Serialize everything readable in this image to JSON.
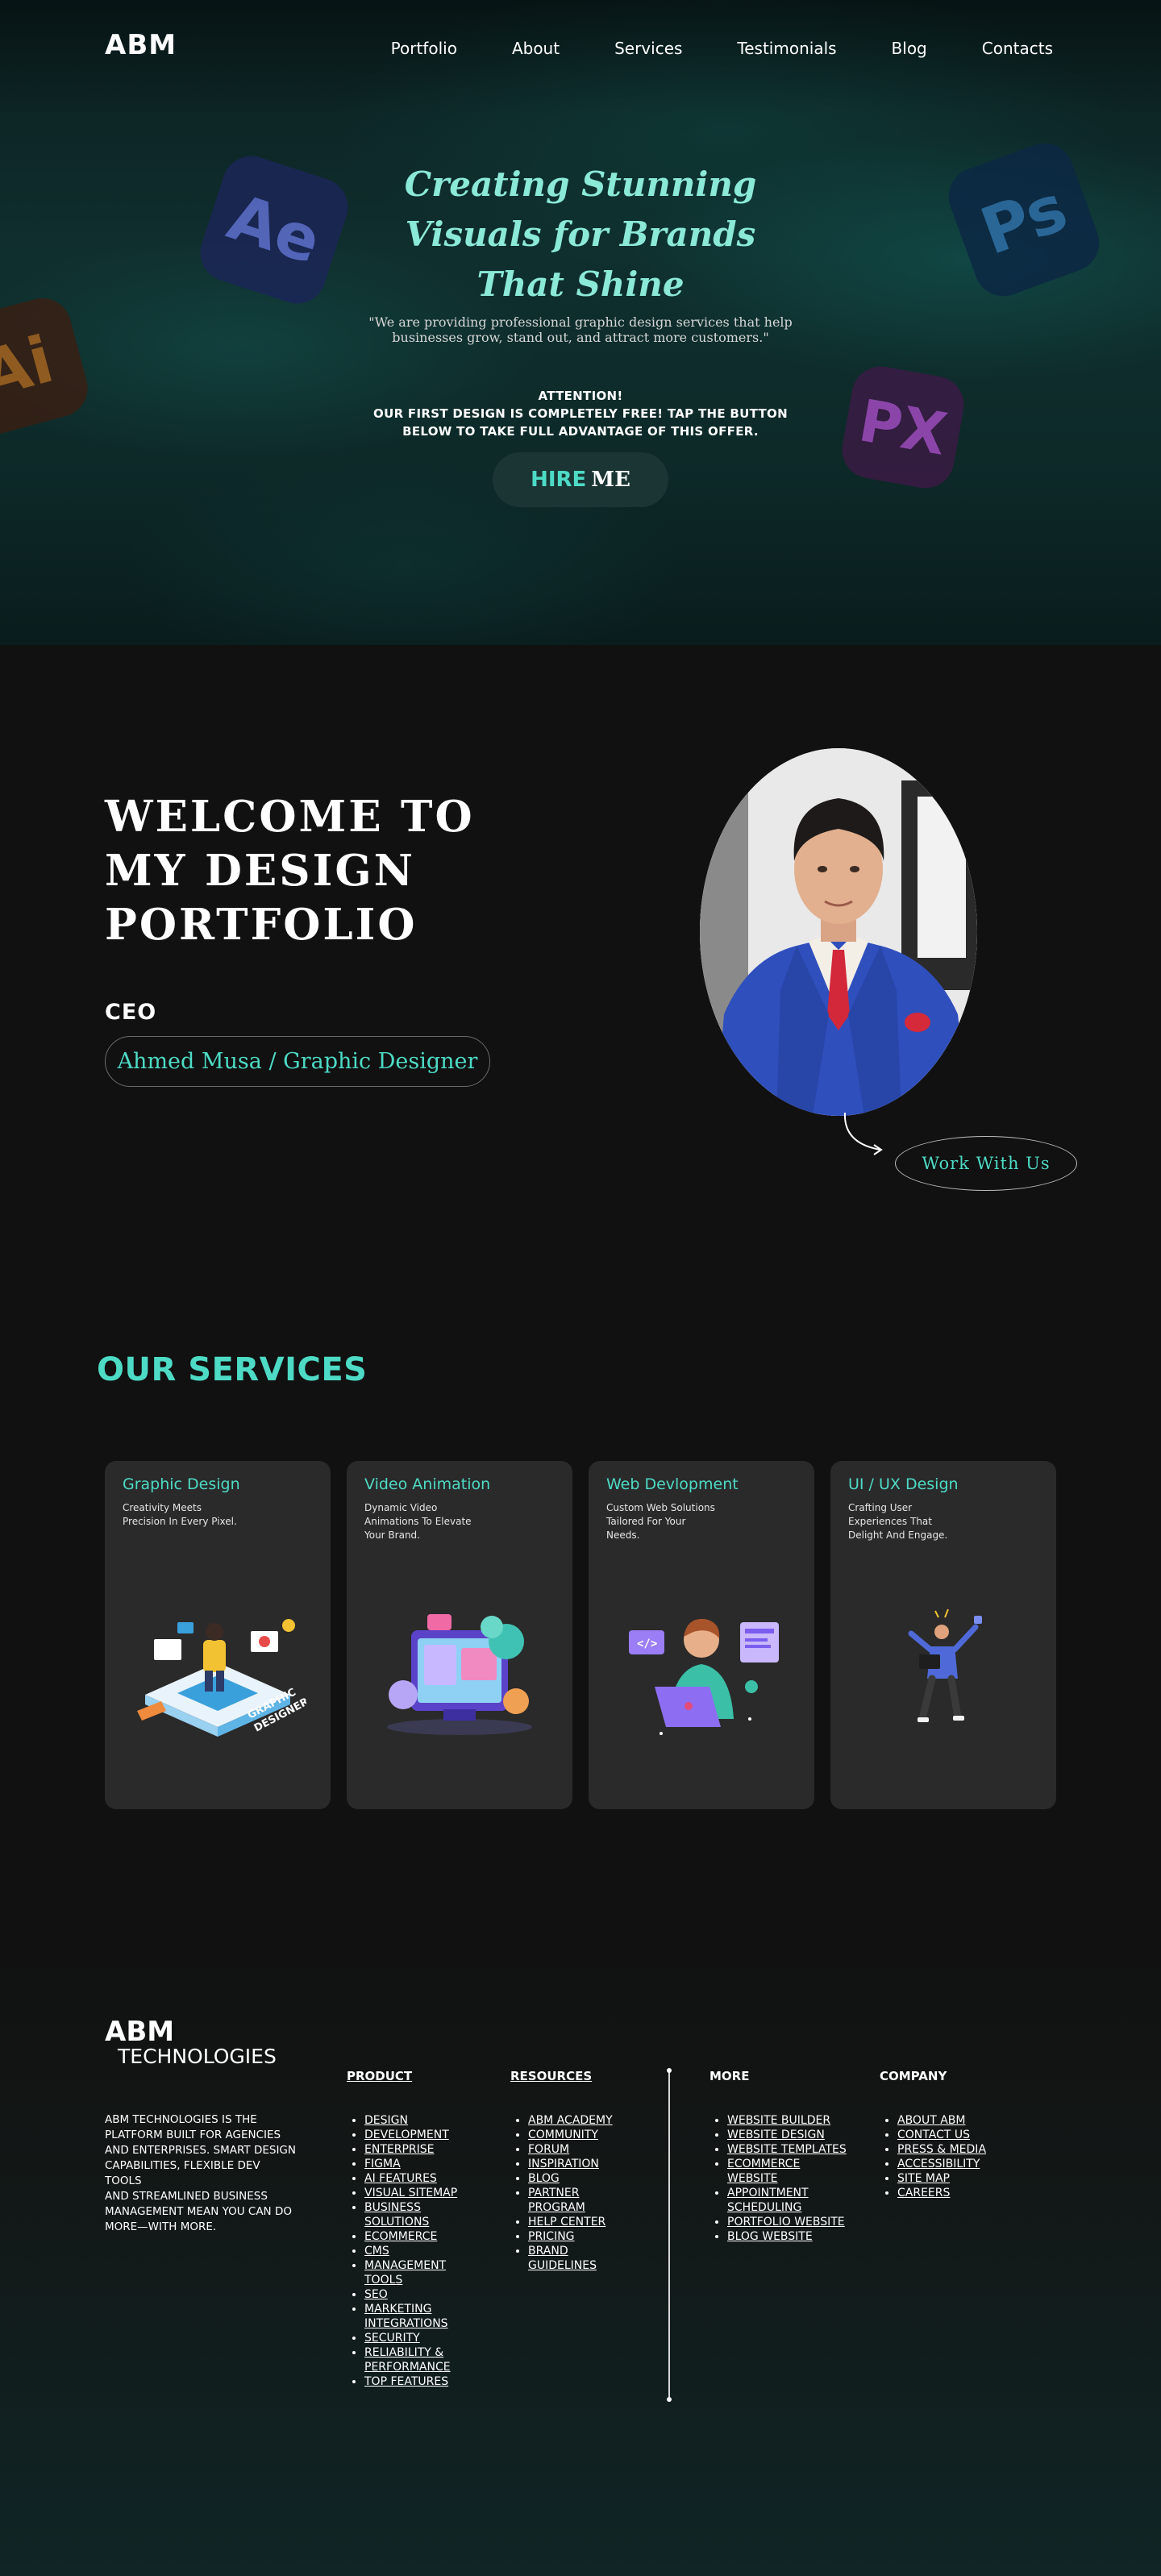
{
  "nav": {
    "logo": "ABM",
    "links": [
      "Portfolio",
      "About",
      "Services",
      "Testimonials",
      "Blog",
      "Contacts"
    ]
  },
  "hero": {
    "title_lines": [
      "Creating Stunning",
      "Visuals for Brands",
      "That Shine"
    ],
    "subtitle_lines": [
      "\"We are providing professional graphic design services that help",
      "businesses grow, stand out, and attract more customers.\""
    ],
    "attention_lines": [
      "ATTENTION!",
      "OUR FIRST DESIGN IS COMPLETELY FREE! TAP THE BUTTON",
      "BELOW TO TAKE FULL ADVANTAGE OF THIS OFFER."
    ],
    "hire_part1": "HIRE",
    "hire_part2": "ME",
    "app_icons": [
      "Ae",
      "Ai",
      "Ps",
      "PX"
    ]
  },
  "welcome": {
    "title_lines": [
      "WELCOME TO",
      "MY DESIGN",
      "PORTFOLIO"
    ],
    "role": "CEO",
    "name": "Ahmed Musa / Graphic Designer",
    "cta": "Work With Us"
  },
  "services": {
    "title": "OUR SERVICES",
    "cards": [
      {
        "title": "Graphic Design",
        "desc_lines": [
          "Creativity Meets",
          "Precision In Every Pixel."
        ],
        "illus_label": [
          "GRAPHIC",
          "DESIGNER"
        ]
      },
      {
        "title": "Video Animation",
        "desc_lines": [
          "Dynamic Video",
          "Animations To Elevate",
          "Your Brand."
        ]
      },
      {
        "title": "Web Devlopment",
        "desc_lines": [
          "Custom Web Solutions",
          "Tailored For Your",
          "Needs."
        ]
      },
      {
        "title": "UI / UX Design",
        "desc_lines": [
          "Crafting User",
          "Experiences That",
          "Delight And Engage."
        ]
      }
    ]
  },
  "footer": {
    "logo": "ABM",
    "logo_sub": "TECHNOLOGIES",
    "about_lines": [
      "ABM technologies is the",
      "platform built for agencies",
      "and enterprises. Smart design",
      "capabilities, flexible dev tools",
      "and streamlined business",
      "management mean you can do",
      "more—with more."
    ],
    "product": {
      "title": "PRODUCT",
      "items": [
        [
          "DESIGN"
        ],
        [
          "DEVELOPMENT"
        ],
        [
          "ENTERPRISE"
        ],
        [
          "FIGMA"
        ],
        [
          "AI FEATURES"
        ],
        [
          "VISUAL SITEMAP"
        ],
        [
          "BUSINESS",
          "SOLUTIONS"
        ],
        [
          "ECOMMERCE"
        ],
        [
          "CMS"
        ],
        [
          "MANAGEMENT",
          "TOOLS"
        ],
        [
          "SEO"
        ],
        [
          "MARKETING",
          "INTEGRATIONS"
        ],
        [
          "SECURITY"
        ],
        [
          "RELIABILITY &",
          "PERFORMANCE"
        ],
        [
          "TOP FEATURES"
        ]
      ]
    },
    "resources": {
      "title": "RESOURCES",
      "items": [
        [
          "ABM ACADEMY"
        ],
        [
          "COMMUNITY"
        ],
        [
          "FORUM"
        ],
        [
          "INSPIRATION"
        ],
        [
          "BLOG"
        ],
        [
          "PARTNER",
          "PROGRAM"
        ],
        [
          "HELP CENTER"
        ],
        [
          "PRICING"
        ],
        [
          "BRAND",
          "GUIDELINES"
        ]
      ]
    },
    "more": {
      "title": "MORE",
      "items": [
        [
          "WEBSITE BUILDER"
        ],
        [
          "WEBSITE DESIGN"
        ],
        [
          "WEBSITE TEMPLATES"
        ],
        [
          "ECOMMERCE",
          "WEBSITE"
        ],
        [
          "APPOINTMENT",
          "SCHEDULING"
        ],
        [
          "PORTFOLIO WEBSITE"
        ],
        [
          "BLOG WEBSITE"
        ]
      ]
    },
    "company": {
      "title": "COMPANY",
      "items": [
        [
          "ABOUT ABM"
        ],
        [
          "CONTACT US"
        ],
        [
          "PRESS & MEDIA"
        ],
        [
          "ACCESSIBILITY"
        ],
        [
          "SITE MAP"
        ],
        [
          "CAREERS"
        ]
      ]
    }
  },
  "colors": {
    "accent": "#4ddbc6",
    "hero_title": "#8be9d8",
    "card_bg": "#2a2a2a",
    "page_bg": "#111111"
  }
}
